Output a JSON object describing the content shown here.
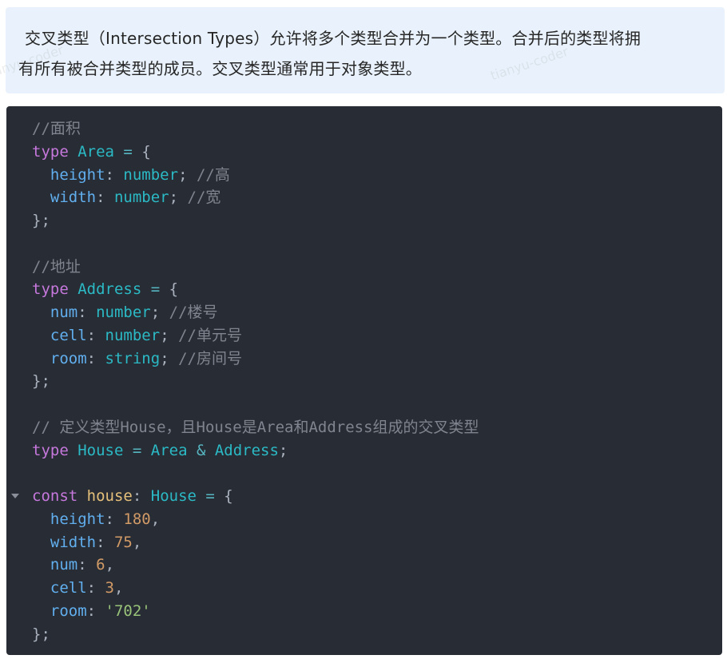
{
  "note": {
    "line1": "交叉类型（Intersection Types）允许将多个类型合并为一个类型。合并后的类型将拥",
    "line2": "有所有被合并类型的成员。交叉类型通常用于对象类型。"
  },
  "watermark": {
    "text": "tianyu-coder"
  },
  "code": {
    "kw_type": "type",
    "kw_const": "const",
    "eq": " = ",
    "open_brace": "{",
    "close_brace": "};",
    "colon": ": ",
    "semi": ";",
    "comma": ",",
    "amp": " & ",
    "area_comment": "//面积",
    "area_name": "Area",
    "height_prop": "height",
    "width_prop": "width",
    "number_type": "number",
    "string_type": "string",
    "height_comment": "//高",
    "width_comment": "//宽",
    "address_comment": "//地址",
    "address_name": "Address",
    "num_prop": "num",
    "cell_prop": "cell",
    "room_prop": "room",
    "num_comment": "//楼号",
    "cell_comment": "//单元号",
    "room_comment": "//房间号",
    "house_comment": "// 定义类型House，且House是Area和Address组成的交叉类型",
    "house_name": "House",
    "house_var": "house",
    "height_val": "180",
    "width_val": "75",
    "num_val": "6",
    "cell_val": "3",
    "room_val": "'702'"
  }
}
